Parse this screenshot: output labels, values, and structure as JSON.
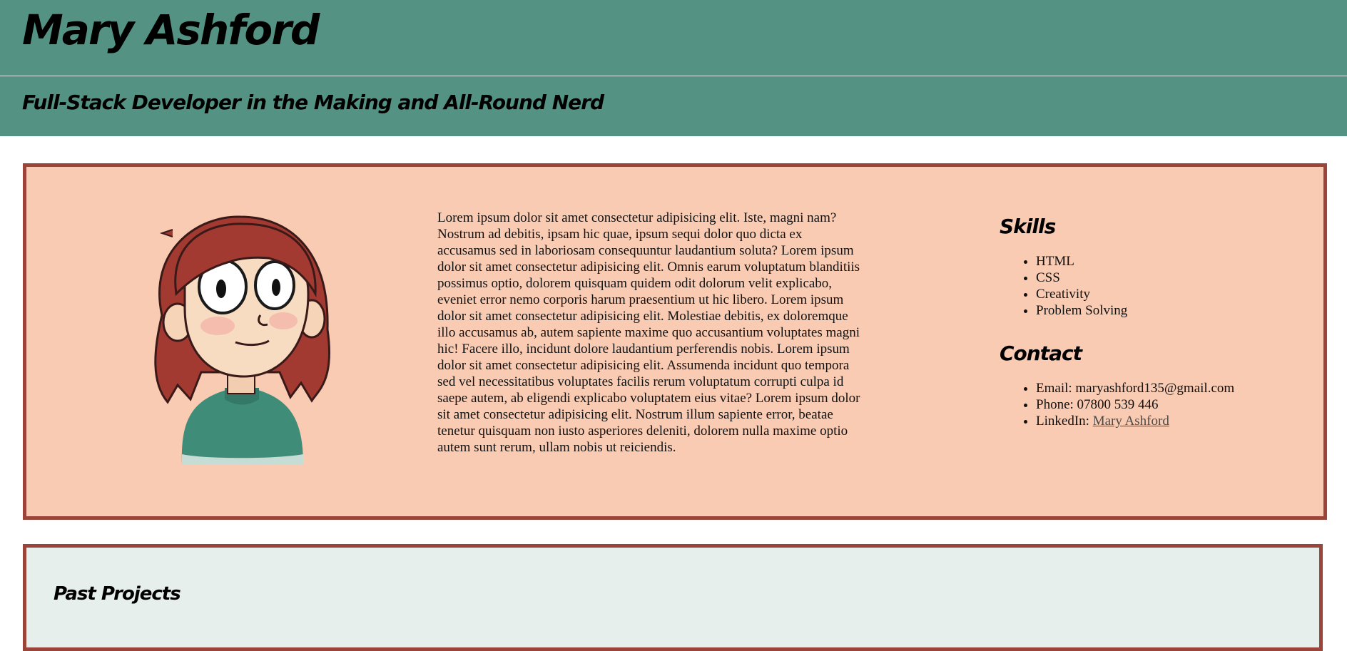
{
  "header": {
    "name": "Mary Ashford",
    "tagline": "Full-Stack Developer in the Making and All-Round Nerd"
  },
  "about": {
    "bio": "Lorem ipsum dolor sit amet consectetur adipisicing elit. Iste, magni nam? Nostrum ad debitis, ipsam hic quae, ipsum sequi dolor quo dicta ex accusamus sed in laboriosam consequuntur laudantium soluta? Lorem ipsum dolor sit amet consectetur adipisicing elit. Omnis earum voluptatum blanditiis possimus optio, dolorem quisquam quidem odit dolorum velit explicabo, eveniet error nemo corporis harum praesentium ut hic libero. Lorem ipsum dolor sit amet consectetur adipisicing elit. Molestiae debitis, ex doloremque illo accusamus ab, autem sapiente maxime quo accusantium voluptates magni hic! Facere illo, incidunt dolore laudantium perferendis nobis. Lorem ipsum dolor sit amet consectetur adipisicing elit. Assumenda incidunt quo tempora sed vel necessitatibus voluptates facilis rerum voluptatum corrupti culpa id saepe autem, ab eligendi explicabo voluptatem eius vitae? Lorem ipsum dolor sit amet consectetur adipisicing elit. Nostrum illum sapiente error, beatae tenetur quisquam non iusto asperiores deleniti, dolorem nulla maxime optio autem sunt rerum, ullam nobis ut reiciendis."
  },
  "skills": {
    "heading": "Skills",
    "items": [
      "HTML",
      "CSS",
      "Creativity",
      "Problem Solving"
    ]
  },
  "contact": {
    "heading": "Contact",
    "email": "Email: maryashford135@gmail.com",
    "phone": "Phone: 07800 539 446",
    "linkedin_label": "LinkedIn: ",
    "linkedin_link": "Mary Ashford"
  },
  "projects": {
    "heading": "Past Projects"
  },
  "colors": {
    "header_bg": "#549383",
    "about_bg": "#f9cbb3",
    "card_border": "#9b4439",
    "projects_bg": "#e7efed"
  },
  "icons": {
    "avatar": "cartoon-avatar-red-hair"
  }
}
